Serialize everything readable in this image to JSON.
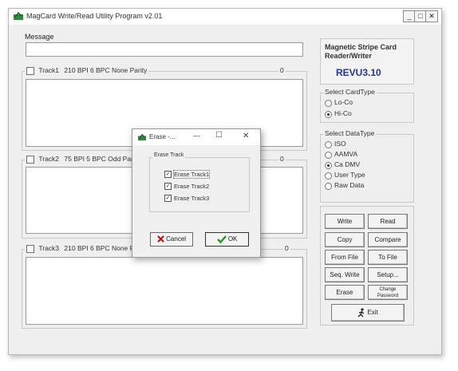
{
  "window": {
    "title": "MagCard Write/Read Utility Program v2.01",
    "minimize": "_",
    "maximize": "□",
    "close": "✕"
  },
  "message": {
    "label": "Message",
    "value": ""
  },
  "tracks": [
    {
      "checkbox_label": "Track1",
      "settings": "210 BPI 6 BPC None Parity",
      "count": "0"
    },
    {
      "checkbox_label": "Track2",
      "settings": "75 BPI 5 BPC Odd Parity",
      "count": "0"
    },
    {
      "checkbox_label": "Track3",
      "settings": "210 BPI 6 BPC None Parity",
      "count": "0"
    }
  ],
  "device": {
    "name": "Magnetic Stripe Card Reader/Writer",
    "version": "REVU3.10",
    "version_color": "#2233aa"
  },
  "card_type": {
    "label": "Select CardType",
    "options": [
      "Lo-Co",
      "Hi-Co"
    ],
    "selected": "Hi-Co"
  },
  "data_type": {
    "label": "Select DataType",
    "options": [
      "ISO",
      "AAMVA",
      "Ca DMV",
      "User Type",
      "Raw Data"
    ],
    "selected": "Ca DMV"
  },
  "buttons": {
    "write": "Write",
    "read": "Read",
    "copy": "Copy",
    "compare": "Compare",
    "from_file": "From File",
    "to_file": "To File",
    "seq_write": "Seq. Write",
    "setup": "Setup...",
    "erase": "Erase",
    "change_password": "Change Password",
    "exit": "Exit"
  },
  "dialog": {
    "title": "Erase -...",
    "minimize": "—",
    "maximize": "☐",
    "close": "✕",
    "group_label": "Erase Track",
    "items": [
      "Erase Track1",
      "Erase Track2",
      "Erase Track3"
    ],
    "checked": [
      true,
      true,
      true
    ],
    "cancel": "Cancel",
    "ok": "OK",
    "cancel_icon_color": "#cc1111",
    "ok_icon_color": "#229922"
  }
}
